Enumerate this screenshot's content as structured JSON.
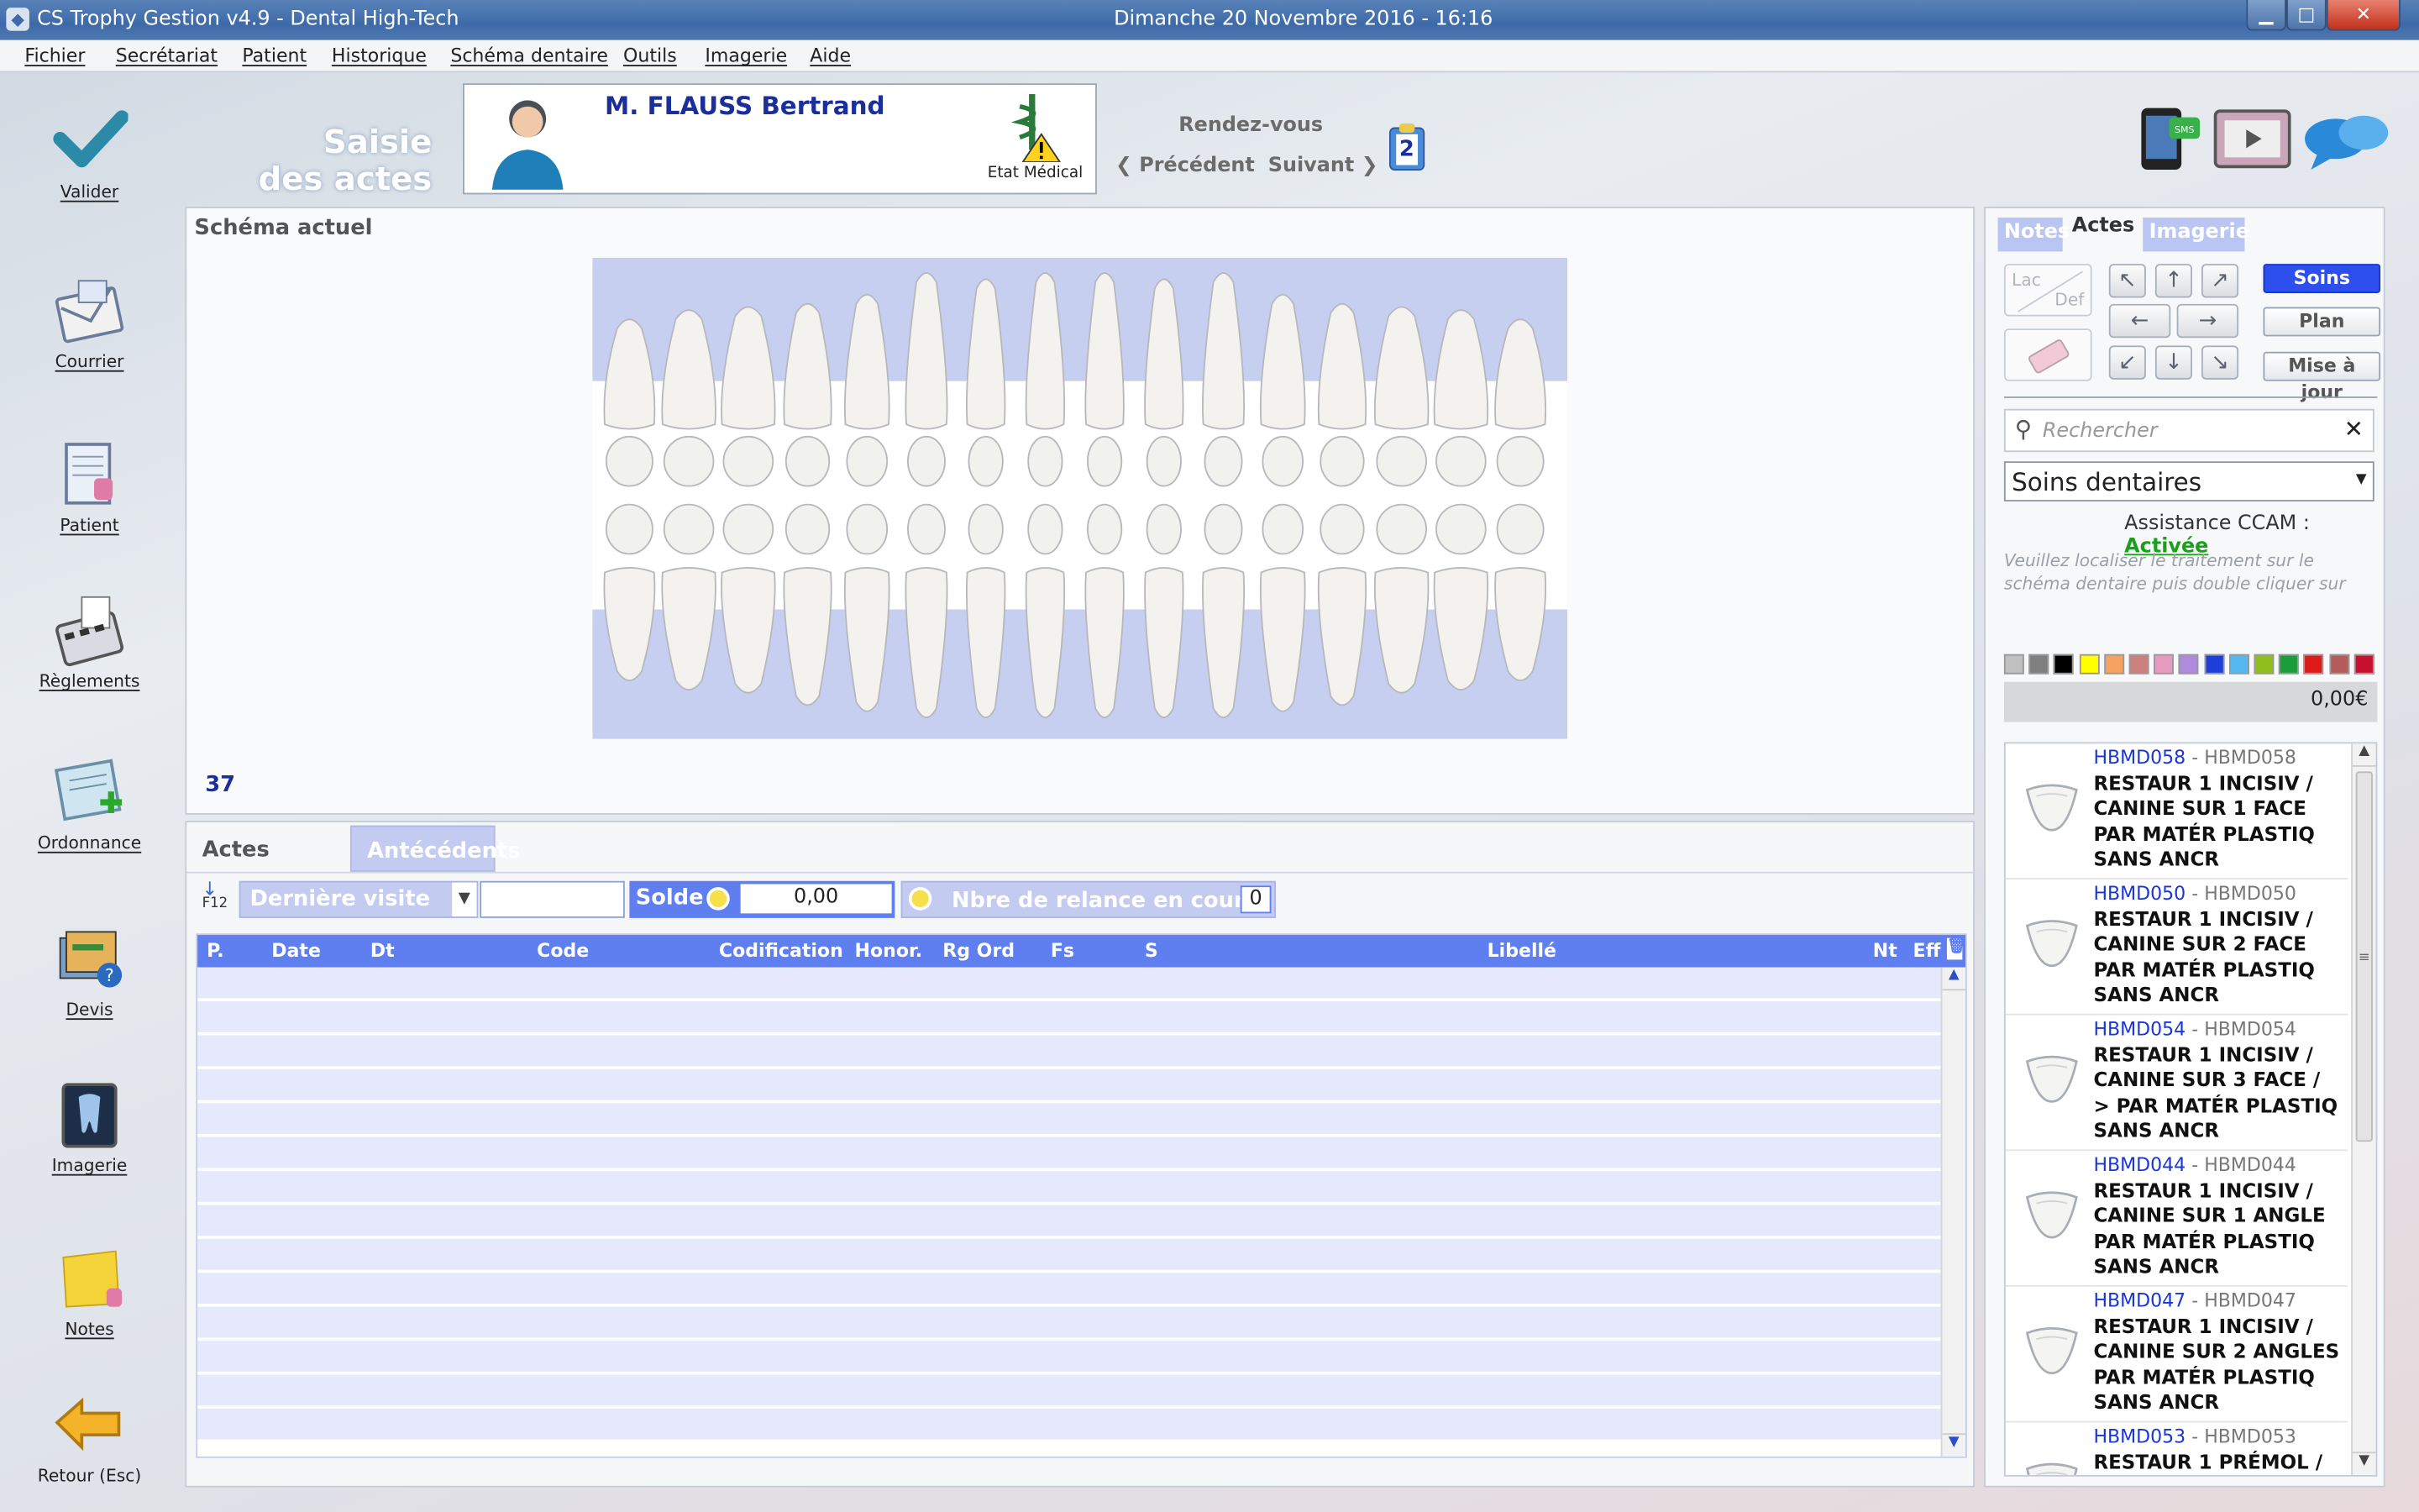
{
  "window": {
    "title": "CS Trophy Gestion v4.9 - Dental High-Tech",
    "datetime": "Dimanche 20 Novembre 2016 -  16:16",
    "minimize": "▁",
    "maximize": "□",
    "close": "✕"
  },
  "menu": [
    "Fichier",
    "Secrétariat",
    "Patient",
    "Historique",
    "Schéma dentaire",
    "Outils",
    "Imagerie",
    "Aide"
  ],
  "toolbar": [
    {
      "label": "Valider",
      "icon": "checkmark-icon"
    },
    {
      "label": "Courrier",
      "icon": "mail-icon"
    },
    {
      "label": "Patient",
      "icon": "patient-file-icon"
    },
    {
      "label": "Règlements",
      "icon": "calculator-icon"
    },
    {
      "label": "Ordonnance",
      "icon": "prescription-icon"
    },
    {
      "label": "Devis",
      "icon": "quote-icon"
    },
    {
      "label": "Imagerie",
      "icon": "xray-icon"
    },
    {
      "label": "Notes",
      "icon": "sticky-note-icon"
    },
    {
      "label": "Retour (Esc)",
      "icon": "back-arrow-icon"
    }
  ],
  "header": {
    "title_line1": "Saisie",
    "title_line2": "des actes",
    "patient_name": "M. FLAUSS Bertrand",
    "etat_medical": "Etat Médical",
    "rendez_vous": "Rendez-vous",
    "precedent": "Précédent",
    "suivant": "Suivant",
    "appointment_count": "2"
  },
  "schema": {
    "title": "Schéma actuel",
    "tooth_number": "37"
  },
  "bottom": {
    "tabs": [
      "Actes",
      "Antécédents"
    ],
    "f12": "F12",
    "derniere_visite": "Dernière visite",
    "solde_label": "Solde",
    "solde_value": "0,00",
    "relance_label": "Nbre de relance en cours",
    "relance_value": "0",
    "columns": [
      "P.",
      "Date",
      "Dt",
      "Code",
      "Codification",
      "Honor.",
      "Rg",
      "Ord",
      "Fs",
      "S",
      "Libellé",
      "Nt",
      "Eff"
    ]
  },
  "right": {
    "tabs": [
      "Notes",
      "Actes",
      "Imagerie"
    ],
    "lac": "Lac",
    "def": "Def",
    "arrows": [
      "↖",
      "↑",
      "↗",
      "←",
      "→",
      "↙",
      "↓",
      "↘"
    ],
    "buttons": [
      "Soins",
      "Plan",
      "Mise à jour"
    ],
    "search_placeholder": "Rechercher",
    "category": "Soins dentaires",
    "ccam_label": "Assistance CCAM :",
    "ccam_value": "Activée",
    "hint": "Veuillez localiser le traitement sur le schéma dentaire puis double cliquer sur l'acte choisi",
    "colors": [
      "#c0c0c0",
      "#808080",
      "#000000",
      "#ffff00",
      "#f4a460",
      "#cd8080",
      "#e79ac0",
      "#b08adc",
      "#1c3fd9",
      "#55b8f0",
      "#8fbf1f",
      "#1b9e3a",
      "#e01919",
      "#b65c5c",
      "#c8102e"
    ],
    "total": "0,00€",
    "acts": [
      {
        "code": "HBMD058",
        "code2": "HBMD058",
        "label": "RESTAUR 1 INCISIV / CANINE SUR 1 FACE PAR MATÉR PLASTIQ SANS ANCR"
      },
      {
        "code": "HBMD050",
        "code2": "HBMD050",
        "label": "RESTAUR 1 INCISIV / CANINE SUR 2 FACE PAR MATÉR PLASTIQ SANS ANCR"
      },
      {
        "code": "HBMD054",
        "code2": "HBMD054",
        "label": "RESTAUR 1 INCISIV / CANINE SUR 3 FACE / > PAR MATÉR PLASTIQ SANS ANCR"
      },
      {
        "code": "HBMD044",
        "code2": "HBMD044",
        "label": "RESTAUR 1 INCISIV / CANINE SUR 1 ANGLE PAR MATÉR PLASTIQ SANS ANCR"
      },
      {
        "code": "HBMD047",
        "code2": "HBMD047",
        "label": "RESTAUR 1 INCISIV / CANINE SUR 2 ANGLES PAR MATÉR PLASTIQ SANS ANCR"
      },
      {
        "code": "HBMD053",
        "code2": "HBMD053",
        "label": "RESTAUR 1 PRÉMOL /"
      }
    ]
  }
}
